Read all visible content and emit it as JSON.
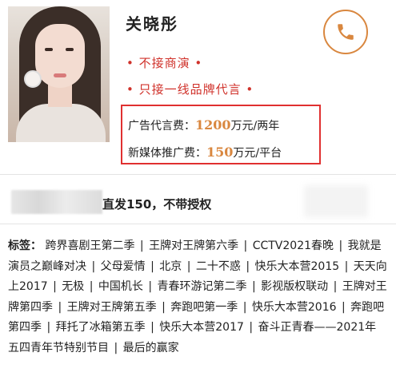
{
  "profile": {
    "name": "关晓彤",
    "bullets": [
      "• 不接商演 •",
      "• 只接一线品牌代言 •"
    ]
  },
  "fees": [
    {
      "label": "广告代言费：",
      "amount": "1200",
      "unit": "万元/两年"
    },
    {
      "label": "新媒体推广费：",
      "amount": "150",
      "unit": "万元/平台"
    }
  ],
  "authorization": {
    "text": "直发150，不带授权"
  },
  "tags": {
    "label": "标签",
    "colon": "：",
    "items": [
      "跨界喜剧王第二季",
      "王牌对王牌第六季",
      "CCTV2021春晚",
      "我就是演员之巅峰对决",
      "父母爱情",
      "北京",
      "二十不惑",
      "快乐大本营2015",
      "天天向上2017",
      "无极",
      "中国机长",
      "青春环游记第二季",
      "影视版权联动",
      "王牌对王牌第四季",
      "王牌对王牌第五季",
      "奔跑吧第一季",
      "快乐大本营2016",
      "奔跑吧第四季",
      "拜托了冰箱第五季",
      "快乐大本营2017",
      "奋斗正青春——2021年五四青年节特别节目",
      "最后的赢家"
    ]
  },
  "icons": {
    "phone": "phone-icon",
    "photo": "profile-photo"
  },
  "colors": {
    "accent": "#d9873f",
    "highlight_border": "#e03030",
    "bullet": "#d0322b"
  }
}
